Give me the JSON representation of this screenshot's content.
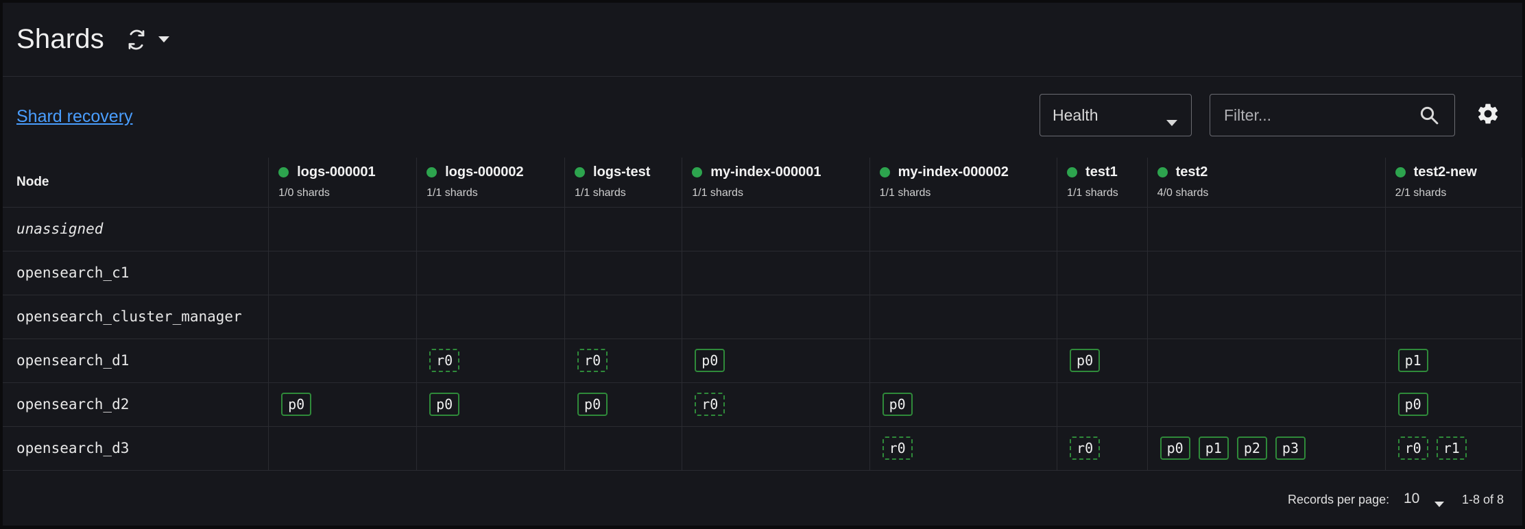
{
  "header": {
    "title": "Shards"
  },
  "toolbar": {
    "recovery_link": "Shard recovery",
    "health_select": "Health",
    "filter_placeholder": "Filter..."
  },
  "table": {
    "node_header": "Node",
    "indices": [
      {
        "name": "logs-000001",
        "count": "1/0 shards"
      },
      {
        "name": "logs-000002",
        "count": "1/1 shards"
      },
      {
        "name": "logs-test",
        "count": "1/1 shards"
      },
      {
        "name": "my-index-000001",
        "count": "1/1 shards"
      },
      {
        "name": "my-index-000002",
        "count": "1/1 shards"
      },
      {
        "name": "test1",
        "count": "1/1 shards"
      },
      {
        "name": "test2",
        "count": "4/0 shards"
      },
      {
        "name": "test2-new",
        "count": "2/1 shards"
      }
    ],
    "rows": [
      {
        "node": "unassigned",
        "italic": true,
        "cells": [
          [],
          [],
          [],
          [],
          [],
          [],
          [],
          []
        ]
      },
      {
        "node": "opensearch_c1",
        "cells": [
          [],
          [],
          [],
          [],
          [],
          [],
          [],
          []
        ]
      },
      {
        "node": "opensearch_cluster_manager",
        "cells": [
          [],
          [],
          [],
          [],
          [],
          [],
          [],
          []
        ]
      },
      {
        "node": "opensearch_d1",
        "cells": [
          [],
          [
            "r0"
          ],
          [
            "r0"
          ],
          [
            "p0"
          ],
          [],
          [
            "p0"
          ],
          [],
          [
            "p1"
          ]
        ]
      },
      {
        "node": "opensearch_d2",
        "cells": [
          [
            "p0"
          ],
          [
            "p0"
          ],
          [
            "p0"
          ],
          [
            "r0"
          ],
          [
            "p0"
          ],
          [],
          [],
          [
            "p0"
          ]
        ]
      },
      {
        "node": "opensearch_d3",
        "cells": [
          [],
          [],
          [],
          [],
          [
            "r0"
          ],
          [
            "r0"
          ],
          [
            "p0",
            "p1",
            "p2",
            "p3"
          ],
          [
            "r0",
            "r1"
          ]
        ]
      }
    ]
  },
  "footer": {
    "records_per_page_label": "Records per page:",
    "records_per_page_value": "10",
    "range": "1-8 of 8"
  },
  "colors": {
    "status_green": "#2da44e",
    "shard_border": "#2f8a3a",
    "link": "#4a9eff"
  },
  "icons": [
    "refresh-icon",
    "chevron-down-icon",
    "search-icon",
    "gear-icon"
  ]
}
